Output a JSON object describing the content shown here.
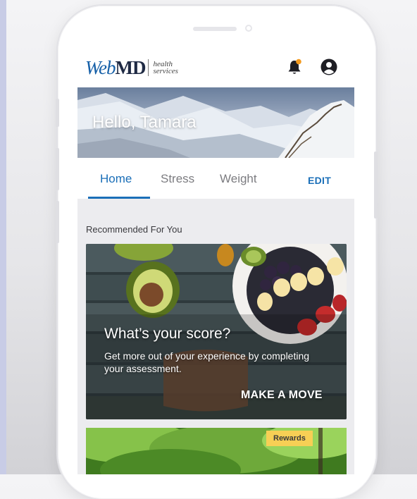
{
  "brand": {
    "logo_primary": "WebMD",
    "logo_primary_part1": "Web",
    "logo_primary_part2": "MD",
    "logo_sub_line1": "health",
    "logo_sub_line2": "services",
    "accent_color": "#1b6fb8"
  },
  "header": {
    "notification_icon": "bell-icon",
    "profile_icon": "user-circle-icon"
  },
  "hero": {
    "greeting": "Hello, Tamara"
  },
  "tabs": {
    "items": [
      {
        "label": "Home",
        "active": true
      },
      {
        "label": "Stress",
        "active": false
      },
      {
        "label": "Weight",
        "active": false
      }
    ],
    "edit_label": "EDIT"
  },
  "recommended": {
    "section_title": "Recommended For You",
    "card": {
      "heading": "What’s your score?",
      "body": "Get more out of your experience by completing your assessment.",
      "cta": "MAKE A MOVE"
    },
    "card2": {
      "badge": "Rewards"
    }
  }
}
